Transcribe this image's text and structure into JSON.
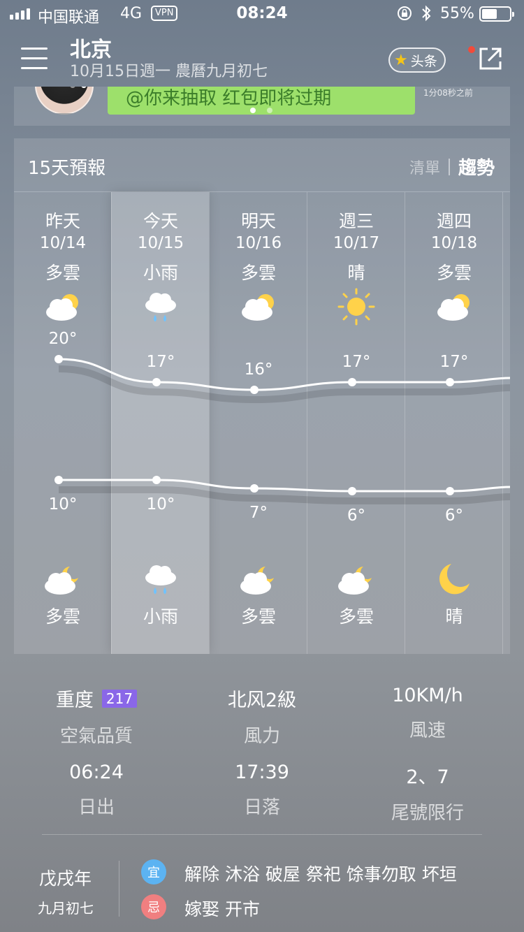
{
  "status_bar": {
    "carrier": "中国联通",
    "network": "4G",
    "vpn": "VPN",
    "time": "08:24",
    "battery_percent": "55%",
    "battery_level": 0.55
  },
  "header": {
    "city": "北京",
    "date_line": "10月15日週一 農曆九月初七",
    "toutiao_label": "头条"
  },
  "banner": {
    "text": "@你来抽取 红包即将过期",
    "time_ago": "1分08秒之前"
  },
  "forecast": {
    "title": "15天預報",
    "view_list": "清單",
    "view_trend": "趨勢",
    "days": [
      {
        "name": "昨天",
        "date": "10/14",
        "day_cond": "多雲",
        "day_icon": "partly-cloudy-day-icon",
        "high": "20°",
        "low": "10°",
        "night_icon": "partly-cloudy-night-icon",
        "night_cond": "多雲"
      },
      {
        "name": "今天",
        "date": "10/15",
        "day_cond": "小雨",
        "day_icon": "light-rain-icon",
        "high": "17°",
        "low": "10°",
        "night_icon": "light-rain-icon",
        "night_cond": "小雨"
      },
      {
        "name": "明天",
        "date": "10/16",
        "day_cond": "多雲",
        "day_icon": "partly-cloudy-day-icon",
        "high": "16°",
        "low": "7°",
        "night_icon": "partly-cloudy-night-icon",
        "night_cond": "多雲"
      },
      {
        "name": "週三",
        "date": "10/17",
        "day_cond": "晴",
        "day_icon": "sun-icon",
        "high": "17°",
        "low": "6°",
        "night_icon": "partly-cloudy-night-icon",
        "night_cond": "多雲"
      },
      {
        "name": "週四",
        "date": "10/18",
        "day_cond": "多雲",
        "day_icon": "partly-cloudy-day-icon",
        "high": "17°",
        "low": "6°",
        "night_icon": "moon-icon",
        "night_cond": "晴"
      }
    ],
    "high_values": [
      20,
      17,
      16,
      17,
      17
    ],
    "low_values": [
      10,
      10,
      7,
      6,
      6
    ]
  },
  "details": {
    "aqi_level": "重度",
    "aqi_value": "217",
    "aqi_label": "空氣品質",
    "wind_dir": "北风2級",
    "wind_dir_label": "風力",
    "wind_speed": "10KM/h",
    "wind_speed_label": "風速",
    "sunrise": "06:24",
    "sunrise_label": "日出",
    "sunset": "17:39",
    "sunset_label": "日落",
    "restriction": "2、7",
    "restriction_label": "尾號限行"
  },
  "almanac": {
    "year": "戊戌年",
    "lunar_date": "九月初七",
    "yi_label": "宜",
    "yi_text": "解除 沐浴 破屋 祭祀 馀事勿取 坏垣",
    "ji_label": "忌",
    "ji_text": "嫁娶 开市"
  },
  "colors": {
    "aqi_badge": "#8a67e8",
    "yi_badge": "#5cb3f2",
    "ji_badge": "#f07f80",
    "banner_green": "#9de06b"
  }
}
